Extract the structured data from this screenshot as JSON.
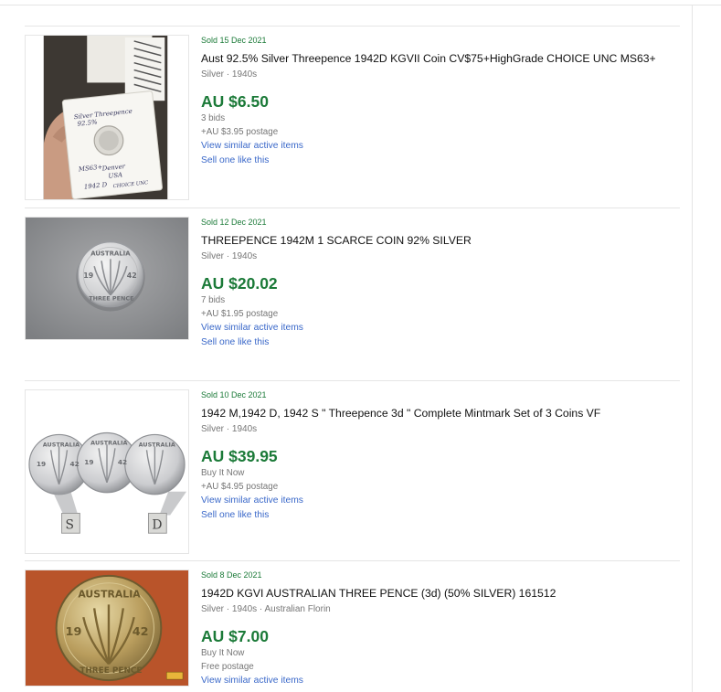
{
  "listings": [
    {
      "sold_date": "Sold 15 Dec 2021",
      "title": "Aust 92.5% Silver Threepence 1942D KGVII Coin CV$75+HighGrade CHOICE UNC MS63+",
      "subtitle": "Silver · 1940s",
      "price": "AU $6.50",
      "sale_info": "3 bids",
      "postage": "+AU $3.95 postage",
      "view_similar": "View similar active items",
      "sell_one": "Sell one like this",
      "image": {
        "kind": "coin-in-holder",
        "holder_text": [
          "Silver Threepence",
          "92.5%",
          "MS63+",
          "Denver",
          "USA",
          "1942 D",
          "CHOICE UNC"
        ]
      }
    },
    {
      "sold_date": "Sold 12 Dec 2021",
      "title": "THREEPENCE 1942M 1 SCARCE COIN 92% SILVER",
      "subtitle": "Silver · 1940s",
      "price": "AU $20.02",
      "sale_info": "7 bids",
      "postage": "+AU $1.95 postage",
      "view_similar": "View similar active items",
      "sell_one": "Sell one like this",
      "image": {
        "kind": "silver-coin-on-grey",
        "coin_text": [
          "AUSTRALIA",
          "19",
          "42",
          "THREE PENCE"
        ]
      }
    },
    {
      "sold_date": "Sold 10 Dec 2021",
      "title": "1942 M,1942 D, 1942 S \" Threepence 3d \" Complete Mintmark Set of 3 Coins VF",
      "subtitle": "Silver · 1940s",
      "price": "AU $39.95",
      "sale_info": "Buy It Now",
      "postage": "+AU $4.95 postage",
      "view_similar": "View similar active items",
      "sell_one": "Sell one like this",
      "image": {
        "kind": "three-coins",
        "mintmarks": [
          "S",
          "D"
        ],
        "coin_text": [
          "AUSTRALIA",
          "19",
          "42"
        ]
      }
    },
    {
      "sold_date": "Sold 8 Dec 2021",
      "title": "1942D KGVI AUSTRALIAN THREE PENCE (3d) (50% SILVER) 161512",
      "subtitle": "Silver · 1940s · Australian Florin",
      "price": "AU $7.00",
      "sale_info": "Buy It Now",
      "postage": "Free postage",
      "view_similar": "View similar active items",
      "sell_one": "",
      "image": {
        "kind": "gold-coin-on-red",
        "coin_text": [
          "AUSTRALIA",
          "19",
          "42",
          "THREE PENCE"
        ]
      }
    }
  ],
  "colors": {
    "sold_green": "#1b7a38",
    "link_blue": "#3a68c9",
    "meta_grey": "#767676",
    "divider": "#e5e5e5"
  }
}
